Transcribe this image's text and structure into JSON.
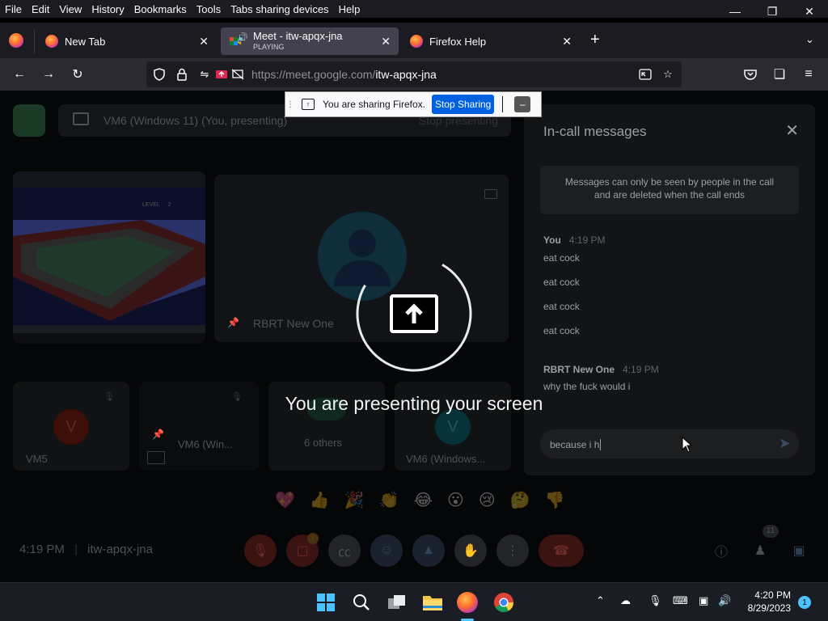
{
  "menu": [
    "File",
    "Edit",
    "View",
    "History",
    "Bookmarks",
    "Tools",
    "Tabs sharing devices",
    "Help"
  ],
  "tabs": [
    {
      "title": "New Tab",
      "sub": ""
    },
    {
      "title": "Meet - itw-apqx-jna",
      "sub": "PLAYING"
    },
    {
      "title": "Firefox Help",
      "sub": ""
    }
  ],
  "url": {
    "prefix": "https://meet.google.com/",
    "path": "itw-apqx-jna"
  },
  "sharing_bar": {
    "text": "You are sharing Firefox.",
    "stop_label": "Stop Sharing",
    "min_label": "–"
  },
  "meet": {
    "presenting_header": "VM6 (Windows 11) (You, presenting)",
    "stop_presenting": "Stop presenting",
    "tiles": [
      {
        "name": "RBRT New One"
      },
      {
        "name": "VM5",
        "initial": "V"
      },
      {
        "name": "VM6 (Win..."
      },
      {
        "name": "6 others"
      },
      {
        "name": "VM6 (Windows...",
        "initial": "V"
      }
    ],
    "game_hud": {
      "level": "LEVEL",
      "level_num": "2"
    },
    "presenting_text": "You are presenting your screen",
    "reactions": [
      "💖",
      "👍",
      "🎉",
      "👏",
      "😂",
      "😮",
      "😢",
      "🤔",
      "👎"
    ],
    "bottom": {
      "time": "4:19 PM",
      "code": "itw-apqx-jna",
      "people_count": "11"
    }
  },
  "chat": {
    "title": "In-call messages",
    "note": "Messages can only be seen by people in the call and are deleted when the call ends",
    "groups": [
      {
        "sender": "You",
        "time": "4:19 PM",
        "messages": [
          "eat cock",
          "eat cock",
          "eat cock",
          "eat cock"
        ]
      },
      {
        "sender": "RBRT New One",
        "time": "4:19 PM",
        "messages": [
          "why the fuck would i"
        ]
      }
    ],
    "draft": "because i h"
  },
  "taskbar": {
    "time": "4:20 PM",
    "date": "8/29/2023",
    "notif": "1"
  }
}
